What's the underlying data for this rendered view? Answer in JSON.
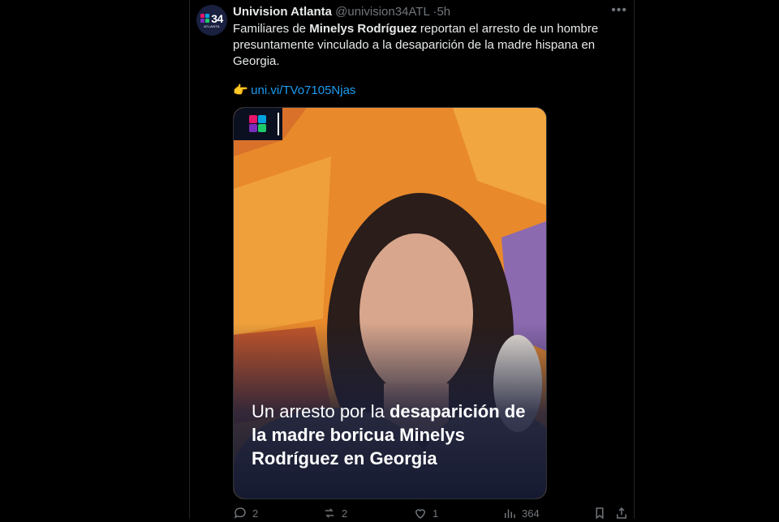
{
  "tweet": {
    "author_name": "Univision Atlanta",
    "handle": "@univision34ATL",
    "time": "5h",
    "more_icon": "more-icon",
    "text_before": "Familiares de ",
    "text_bold": "Minelys Rodríguez",
    "text_after": " reportan el arresto de un hombre presuntamente vinculado a la desaparición de la madre hispana en Georgia.",
    "link_emoji": "👉",
    "link_text": "uni.vi/TVo7105Njas"
  },
  "avatar": {
    "number": "34",
    "city": "ATLANTA"
  },
  "media": {
    "caption_light": "Un arresto por la ",
    "caption_bold": "desaparición de la madre boricua Minelys Rodríguez en Georgia",
    "logo_icon": "univision-logo-icon",
    "colors": {
      "background": "#e8892b",
      "overlay": "#1a1f3a"
    }
  },
  "actions": {
    "replies": "2",
    "reposts": "2",
    "likes": "1",
    "views": "364"
  },
  "colors": {
    "link": "#1d9bf0",
    "muted": "#71767b",
    "text": "#e7e9ea"
  }
}
